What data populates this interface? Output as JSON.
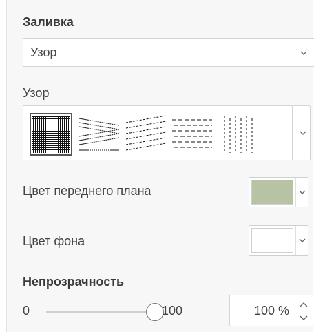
{
  "fill": {
    "title": "Заливка",
    "type_value": "Узор"
  },
  "pattern": {
    "label": "Узор",
    "swatches": [
      "grid-pattern",
      "wave-lines-pattern",
      "diagonal-lines-pattern",
      "dashed-lines-pattern",
      "vertical-dashes-pattern"
    ],
    "selected_index": 0
  },
  "foreground": {
    "label": "Цвет переднего плана",
    "color": "#b8c2a4"
  },
  "background": {
    "label": "Цвет фона",
    "color": "#ffffff"
  },
  "opacity": {
    "title": "Непрозрачность",
    "min_label": "0",
    "max_label": "100",
    "value": 100,
    "value_text": "100 %"
  },
  "icons": {
    "dropdown": "chevron-down-icon",
    "spinner": "up-down-spinner-icon"
  }
}
